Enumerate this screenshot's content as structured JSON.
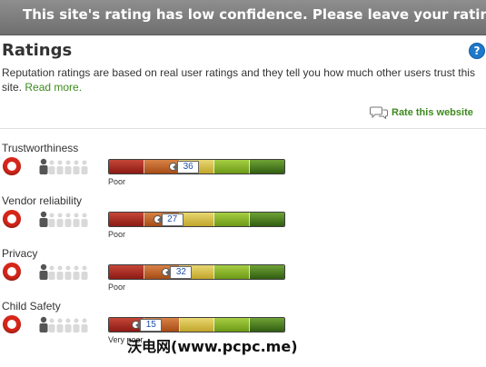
{
  "banner": {
    "text": "This site's rating has low confidence. Please leave your rating."
  },
  "header": {
    "title": "Ratings",
    "help_icon": "help-icon",
    "help_glyph": "?"
  },
  "description": {
    "text": "Reputation ratings are based on real user ratings and they tell you how much other users trust this site.",
    "link": "Read more."
  },
  "rate_action": {
    "label": "Rate this website",
    "icon": "speech-bubbles-icon"
  },
  "colors": {
    "brand_red": "#d6261a",
    "link_green": "#3d8a1e",
    "banner_gray": "#7f7f7f",
    "scale": [
      "#a82a20",
      "#c0622b",
      "#d6bf4c",
      "#88b52d",
      "#4a7d22"
    ]
  },
  "ratings": [
    {
      "label": "Trustworthiness",
      "score": "36",
      "level": "Poor"
    },
    {
      "label": "Vendor reliability",
      "score": "27",
      "level": "Poor"
    },
    {
      "label": "Privacy",
      "score": "32",
      "level": "Poor"
    },
    {
      "label": "Child Safety",
      "score": "15",
      "level": "Very poor"
    }
  ],
  "watermark": "沃电网(www.pcpc.me)"
}
